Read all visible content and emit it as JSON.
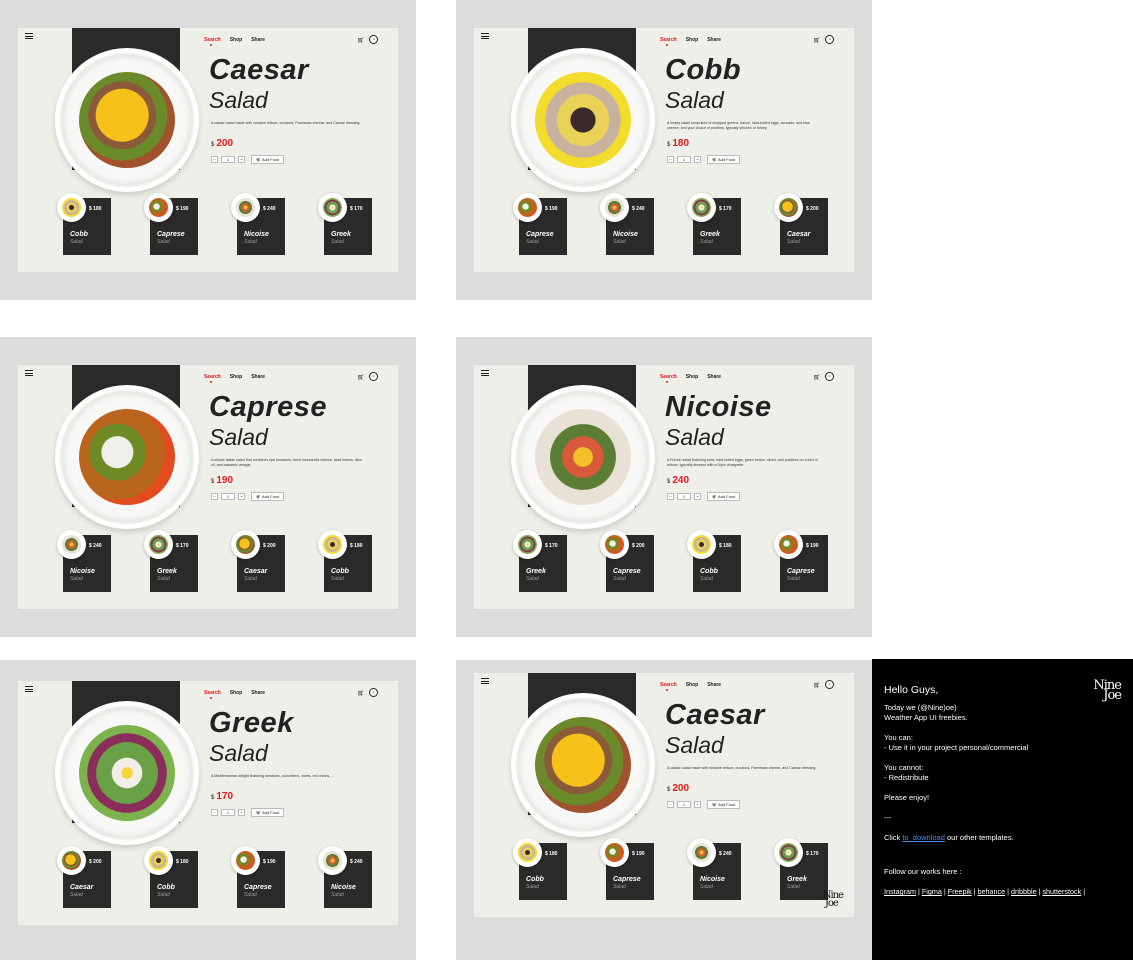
{
  "nav": {
    "search": "Search",
    "shop": "Shop",
    "share": "Share"
  },
  "icons": {
    "menu": "menu-icon",
    "cart": "cart-icon",
    "avatar": "avatar-icon"
  },
  "controls": {
    "minus": "−",
    "qty": "1",
    "plus": "+",
    "add": "Add Food"
  },
  "currency": "$",
  "salad_word": "Salad",
  "colors": {
    "accent": "#e01b1b",
    "card_bg": "#efefea",
    "dark": "#2a2a2a"
  },
  "screens": [
    {
      "name": "Caesar",
      "price": "200",
      "desc": "A classic salad made with romaine lettuce, croutons, Parmesan cheese, and Caesar dressing.",
      "thumbs": [
        {
          "name": "Cobb",
          "price": "$ 180"
        },
        {
          "name": "Caprese",
          "price": "$ 190"
        },
        {
          "name": "Nicoise",
          "price": "$ 240"
        },
        {
          "name": "Greek",
          "price": "$ 170"
        }
      ]
    },
    {
      "name": "Cobb",
      "price": "180",
      "desc": "A hearty salad comprised of chopped greens, bacon, hard-boiled eggs, avocado, and blue cheese, and your choice of proteins, typically chicken or turkey.",
      "thumbs": [
        {
          "name": "Caprese",
          "price": "$ 190"
        },
        {
          "name": "Nicoise",
          "price": "$ 240"
        },
        {
          "name": "Greek",
          "price": "$ 170"
        },
        {
          "name": "Caesar",
          "price": "$ 200"
        }
      ]
    },
    {
      "name": "Caprese",
      "price": "190",
      "desc": "A simple Italian salad that combines ripe tomatoes, fresh mozzarella cheese, basil leaves, olive oil, and balsamic vinegar.",
      "thumbs": [
        {
          "name": "Nicoise",
          "price": "$ 240"
        },
        {
          "name": "Greek",
          "price": "$ 170"
        },
        {
          "name": "Caesar",
          "price": "$ 200"
        },
        {
          "name": "Cobb",
          "price": "$ 180"
        }
      ]
    },
    {
      "name": "Nicoise",
      "price": "240",
      "desc": "A French salad featuring tuna, hard-boiled eggs, green beans, olives, and potatoes on a bed of lettuce, typically dressed with a Dijon vinaigrette.",
      "thumbs": [
        {
          "name": "Greek",
          "price": "$ 170"
        },
        {
          "name": "Caprese",
          "price": "$ 200"
        },
        {
          "name": "Cobb",
          "price": "$ 180"
        },
        {
          "name": "Caprese",
          "price": "$ 190"
        }
      ]
    },
    {
      "name": "Greek",
      "price": "170",
      "desc": "A Mediterranean delight featuring tomatoes, cucumbers, olives, red onions, ...",
      "thumbs": [
        {
          "name": "Caesar",
          "price": "$ 200"
        },
        {
          "name": "Cobb",
          "price": "$ 180"
        },
        {
          "name": "Caprese",
          "price": "$ 190"
        },
        {
          "name": "Nicoise",
          "price": "$ 240"
        }
      ]
    },
    {
      "name": "Caesar",
      "price": "200",
      "desc": "A classic salad made with romaine lettuce, croutons, Parmesan cheese, and Caesar dressing.",
      "thumbs": [
        {
          "name": "Cobb",
          "price": "$ 180"
        },
        {
          "name": "Caprese",
          "price": "$ 190"
        },
        {
          "name": "Nicoise",
          "price": "$ 240"
        },
        {
          "name": "Greek",
          "price": "$ 170"
        }
      ]
    }
  ],
  "logo": {
    "line1": "Nine",
    "line2": "Joe"
  },
  "info": {
    "greeting": "Hello Guys,",
    "intro1": "Today we (@Nine)oe)",
    "intro2": "Weather App UI freebies.",
    "can_title": "You can:",
    "can_item": "- Use it in your project personal/commercial",
    "cannot_title": "You cannot:",
    "cannot_item": "- Redistribute",
    "enjoy": "Please enjoy!",
    "dash": "---",
    "click_pre": "Click",
    "click_link": "to_download",
    "click_post": "our other templates.",
    "follow": "Follow our works here :",
    "links": [
      "Instagram",
      "Figma",
      "Freepik",
      "behance",
      "dribbble",
      "shutterstock"
    ]
  }
}
